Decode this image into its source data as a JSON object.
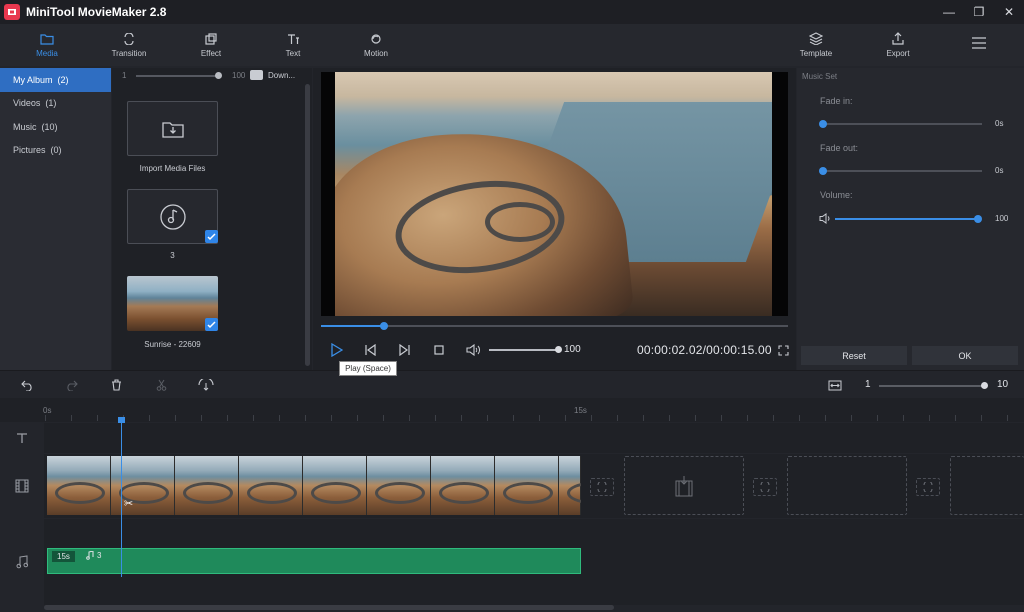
{
  "window": {
    "title": "MiniTool MovieMaker 2.8",
    "controls": [
      "minimize-icon",
      "restore-icon",
      "close-icon"
    ]
  },
  "toolbar": {
    "tabs": [
      {
        "label": "Media",
        "icon": "folder-icon",
        "active": true
      },
      {
        "label": "Transition",
        "icon": "transition-icon"
      },
      {
        "label": "Effect",
        "icon": "effect-icon"
      },
      {
        "label": "Text",
        "icon": "text-icon"
      },
      {
        "label": "Motion",
        "icon": "motion-icon"
      }
    ],
    "right": [
      {
        "label": "Template",
        "icon": "layers-icon"
      },
      {
        "label": "Export",
        "icon": "export-icon"
      }
    ],
    "menu_icon": "hamburger-icon"
  },
  "sidebar": {
    "items": [
      {
        "label": "My Album",
        "count": "(2)",
        "active": true
      },
      {
        "label": "Videos",
        "count": "(1)"
      },
      {
        "label": "Music",
        "count": "(10)"
      },
      {
        "label": "Pictures",
        "count": "(0)"
      }
    ]
  },
  "media": {
    "zoom_min": "1",
    "zoom_max": "100",
    "zoom_level": 0.97,
    "download_label": "Down...",
    "items": [
      {
        "label": "Import Media Files",
        "icon": "import-icon"
      },
      {
        "label": "3",
        "icon": "music-note-icon",
        "checked": true
      },
      {
        "label": "Sunrise - 22609",
        "icon": "video-thumbnail",
        "checked": true
      }
    ]
  },
  "preview": {
    "progress": 0.135,
    "volume_value": "100",
    "volume_level": 1.0,
    "timecode": "00:00:02.02/00:00:15.00",
    "tooltip": "Play (Space)",
    "controls": [
      "play-icon",
      "prev-frame-icon",
      "next-frame-icon",
      "stop-icon",
      "volume-icon",
      "fullscreen-icon"
    ]
  },
  "music_set": {
    "title": "Music Set",
    "fade_in": {
      "label": "Fade in:",
      "value": "0s",
      "level": 0
    },
    "fade_out": {
      "label": "Fade out:",
      "value": "0s",
      "level": 0
    },
    "volume": {
      "label": "Volume:",
      "value": "100",
      "level": 1.0
    },
    "reset_label": "Reset",
    "ok_label": "OK"
  },
  "timeline_toolbar": {
    "icons": [
      "undo-icon",
      "redo-icon",
      "delete-icon",
      "cut-icon",
      "audio-split-icon"
    ],
    "fit_icon": "fit-zoom-icon",
    "zoom_min": "1",
    "zoom_max": "10",
    "zoom_level": 1.0
  },
  "timeline": {
    "ruler": [
      "0s",
      "15s"
    ],
    "audio_clip": {
      "duration": "15s",
      "name": "3"
    },
    "playhead_time": "00:00:02.02"
  }
}
